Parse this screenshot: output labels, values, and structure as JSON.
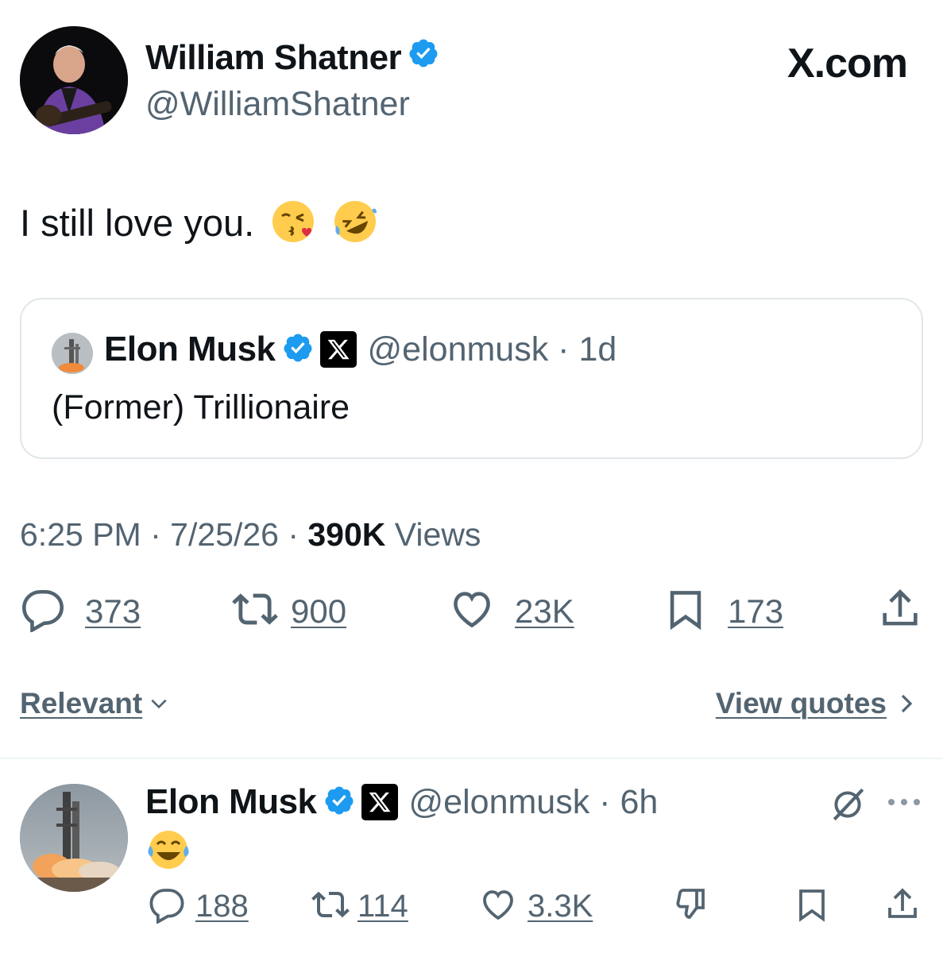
{
  "brand": "X.com",
  "tweet": {
    "author_name": "William Shatner",
    "author_handle": "@WilliamShatner",
    "text": "I still love you.",
    "emojis": [
      "kissing-face-heart-emoji",
      "rolling-laughing-emoji"
    ],
    "quote": {
      "name": "Elon Musk",
      "handle": "@elonmusk",
      "time": "1d",
      "text": "(Former) Trillionaire"
    },
    "meta": {
      "time": "6:25 PM",
      "date": "7/25/26",
      "views_count": "390K",
      "views_label": "Views"
    },
    "actions": {
      "replies": "373",
      "reposts": "900",
      "likes": "23K",
      "bookmarks": "173"
    }
  },
  "sort": {
    "label": "Relevant"
  },
  "view_quotes": {
    "label": "View quotes"
  },
  "reply": {
    "name": "Elon Musk",
    "handle": "@elonmusk",
    "time": "6h",
    "emoji": "face-with-tears-of-joy-emoji",
    "actions": {
      "replies": "188",
      "reposts": "114",
      "likes": "3.3K"
    }
  },
  "colors": {
    "text": "#0f1419",
    "secondary": "#536471",
    "verified": "#1d9bf0",
    "border": "#e1e6ea"
  }
}
